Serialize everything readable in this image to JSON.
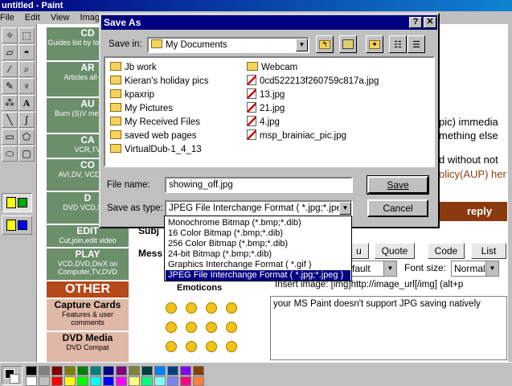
{
  "paint": {
    "title": "untitled - Paint",
    "menu": [
      "File",
      "Edit",
      "View",
      "Image"
    ]
  },
  "webpage": {
    "sidebar": [
      {
        "h": "CD",
        "d": "Guides list by tools, all-in"
      },
      {
        "h": "AR",
        "d": "Articles all-in-o"
      },
      {
        "h": "AU",
        "d": "Burn (S)V menu,pho"
      },
      {
        "h": "CA",
        "d": "VCR,TV"
      },
      {
        "h": "CO",
        "d": "AVI,DV, VCD,SVC"
      },
      {
        "h": "EDIT",
        "d": "Cut,join,edit video"
      },
      {
        "h": "PLAY",
        "d": "VCD,DVD,DivX on Computer,TV,DVD"
      }
    ],
    "sidebar_hidden": [
      {
        "h": "D",
        "d": "DVD VCD,SVC"
      }
    ],
    "other_heading": "OTHER",
    "pink": [
      {
        "h": "Capture Cards",
        "d": "Features & user comments"
      },
      {
        "h": "DVD Media",
        "d": "DVD Compat"
      }
    ],
    "right_texts": {
      "t1": "pic) immedia",
      "t2": "mething else",
      "t3": "d without not",
      "t4": "olicy(AUP) her"
    },
    "reply": "reply",
    "subject_label": "Subj",
    "message_label": "Mess",
    "buttons": [
      "u",
      "Quote",
      "Code",
      "List"
    ],
    "font_select": "fault",
    "font_size_label": "Font size:",
    "font_size_value": "Normal",
    "insert_image": "Insert image: [img]http://image_url[/img]  (alt+p",
    "message_text": "your MS Paint doesn't support JPG saving natively",
    "emoticons_label": "Emoticons"
  },
  "dialog": {
    "title": "Save As",
    "help_btn": "?",
    "close_btn": "✕",
    "save_in_label": "Save in:",
    "save_in_value": "My Documents",
    "files_col1": [
      {
        "name": "Jb work",
        "icon": "folder-icon"
      },
      {
        "name": "Kieran's holiday pics",
        "icon": "folder-icon"
      },
      {
        "name": "kpaxrip",
        "icon": "folder-icon"
      },
      {
        "name": "My Pictures",
        "icon": "folder-icon"
      },
      {
        "name": "My Received Files",
        "icon": "folder-icon"
      },
      {
        "name": "saved web pages",
        "icon": "folder-icon"
      },
      {
        "name": "VirtualDub-1_4_13",
        "icon": "folder-icon"
      }
    ],
    "files_col2": [
      {
        "name": "Webcam",
        "icon": "folder-icon"
      },
      {
        "name": "0cd522213f260759c817a.jpg",
        "icon": "image-file-icon"
      },
      {
        "name": "13.jpg",
        "icon": "image-file-icon"
      },
      {
        "name": "21.jpg",
        "icon": "image-file-icon"
      },
      {
        "name": "4.jpg",
        "icon": "image-file-icon"
      },
      {
        "name": "msp_brainiac_pic.jpg",
        "icon": "image-file-icon"
      }
    ],
    "filename_label": "File name:",
    "filename_value": "showing_off.jpg",
    "type_label": "Save as type:",
    "type_value": "JPEG File Interchange Format ( *.jpg;*.jpeg )",
    "save_btn": "Save",
    "cancel_btn": "Cancel",
    "type_options": [
      "Monochrome Bitmap (*.bmp;*.dib)",
      "16 Color Bitmap (*.bmp;*.dib)",
      "256 Color Bitmap (*.bmp;*.dib)",
      "24-bit Bitmap (*.bmp;*.dib)",
      "Graphics Interchange Format ( *.gif )",
      "JPEG File Interchange Format ( *.jpg;*.jpeg )"
    ],
    "selected_option": 5
  },
  "palette_colors": [
    "#000000",
    "#808080",
    "#800000",
    "#808000",
    "#008000",
    "#008080",
    "#000080",
    "#800080",
    "#808040",
    "#004040",
    "#0080ff",
    "#004080",
    "#8000ff",
    "#804000",
    "#ffffff",
    "#c0c0c0",
    "#ff0000",
    "#ffff00",
    "#00ff00",
    "#00ffff",
    "#0000ff",
    "#ff00ff",
    "#ffff80",
    "#00ff80",
    "#80ffff",
    "#8080ff",
    "#ff0080",
    "#ff8040"
  ]
}
